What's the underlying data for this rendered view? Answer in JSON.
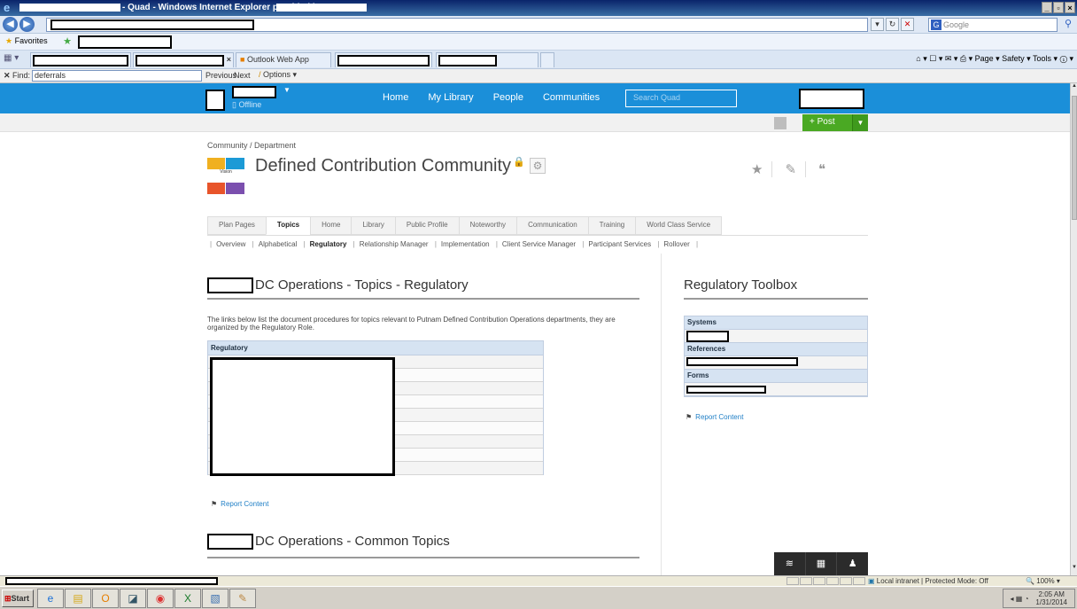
{
  "browser": {
    "window_title": "- Quad - Windows Internet Explorer provided by",
    "search_placeholder": "Google",
    "favorites_label": "Favorites",
    "tab_outlook": "Outlook Web App",
    "tab_tools": "Page ▾  Safety ▾  Tools ▾",
    "find_label": "Find:",
    "find_value": "deferrals",
    "find_previous": "Previous",
    "find_next": "Next",
    "find_options": "Options ▾"
  },
  "quad": {
    "offline": "Offline",
    "nav": [
      "Home",
      "My Library",
      "People",
      "Communities"
    ],
    "search_placeholder": "Search Quad",
    "post_label": "+ Post"
  },
  "community": {
    "breadcrumb": "Community / Department",
    "title": "Defined Contribution Community",
    "tabs": [
      "Plan Pages",
      "Topics",
      "Home",
      "Library",
      "Public Profile",
      "Noteworthy",
      "Communication",
      "Training",
      "World Class Service"
    ],
    "active_tab": "Topics",
    "subtabs": [
      "Overview",
      "Alphabetical",
      "Regulatory",
      "Relationship Manager",
      "Implementation",
      "Client Service Manager",
      "Participant Services",
      "Rollover"
    ],
    "active_subtab": "Regulatory"
  },
  "main": {
    "section1_title": "DC Operations - Topics - Regulatory",
    "description": "The links below list the document procedures for topics relevant to Putnam Defined Contribution Operations departments, they are organized by the Regulatory Role.",
    "table_header": "Regulatory",
    "report_content": "Report Content",
    "section2_title": "DC Operations - Common Topics"
  },
  "sidebar": {
    "title": "Regulatory Toolbox",
    "systems": "Systems",
    "references": "References",
    "forms": "Forms",
    "report_content": "Report Content"
  },
  "statusbar": {
    "zone": "Local intranet | Protected Mode: Off",
    "zoom": "100%"
  },
  "taskbar": {
    "start": "Start",
    "time": "2:05 AM",
    "date": "1/31/2014"
  }
}
